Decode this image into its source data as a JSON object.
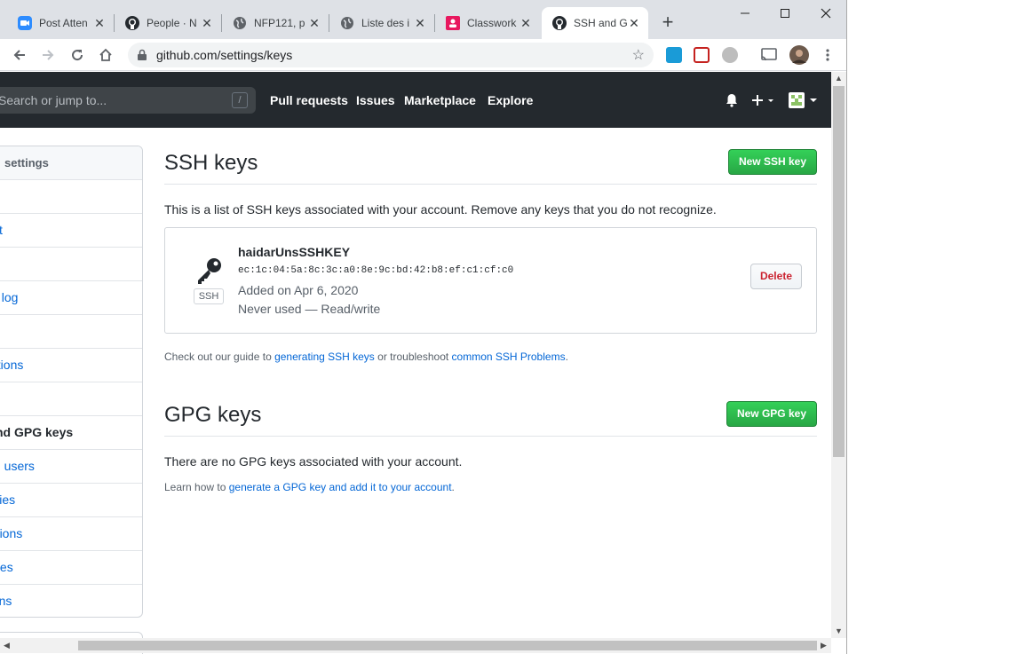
{
  "browser": {
    "tabs": [
      {
        "title": "Post Atten",
        "icon": "zoom-icon"
      },
      {
        "title": "People · N",
        "icon": "github-icon"
      },
      {
        "title": "NFP121, p",
        "icon": "globe-icon"
      },
      {
        "title": "Liste des i",
        "icon": "globe-icon"
      },
      {
        "title": "Classwork",
        "icon": "classroom-icon"
      },
      {
        "title": "SSH and G",
        "icon": "github-icon"
      }
    ],
    "url": "github.com/settings/keys"
  },
  "gh_header": {
    "search_placeholder": "Search or jump to...",
    "search_shortcut": "/",
    "nav": [
      "Pull requests",
      "Issues",
      "Marketplace",
      "Explore"
    ]
  },
  "sidebar": {
    "title": "Personal settings",
    "title_visible": "settings",
    "items": [
      "",
      "t",
      "",
      "ty log",
      "",
      "ations",
      "",
      "nd GPG keys",
      "d users",
      "ositories",
      "nizations",
      "ed replies",
      "plications"
    ]
  },
  "ssh": {
    "title": "SSH keys",
    "new_button": "New SSH key",
    "description": "This is a list of SSH keys associated with your account. Remove any keys that you do not recognize.",
    "key": {
      "name": "haidarUnsSSHKEY",
      "fingerprint": "ec:1c:04:5a:8c:3c:a0:8e:9c:bd:42:b8:ef:c1:cf:c0",
      "added": "Added on Apr 6, 2020",
      "usage": "Never used — Read/write",
      "type_label": "SSH",
      "delete_button": "Delete"
    },
    "note_prefix": "Check out our guide to ",
    "note_link1": "generating SSH keys",
    "note_middle": " or troubleshoot ",
    "note_link2": "common SSH Problems",
    "note_suffix": "."
  },
  "gpg": {
    "title": "GPG keys",
    "new_button": "New GPG key",
    "empty": "There are no GPG keys associated with your account.",
    "note_prefix": "Learn how to ",
    "note_link": "generate a GPG key and add it to your account",
    "note_suffix": "."
  },
  "colors": {
    "gh_dark": "#24292e",
    "link": "#0366d6",
    "green": "#28a745",
    "danger": "#cb2431"
  }
}
